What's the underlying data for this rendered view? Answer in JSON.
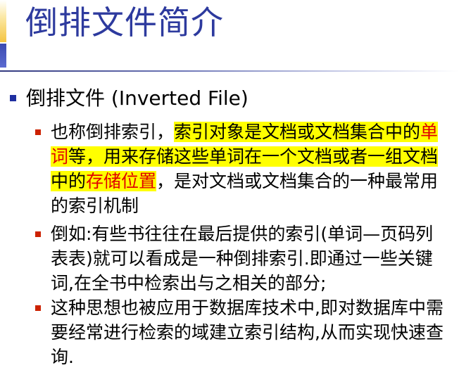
{
  "title": "倒排文件简介",
  "heading": "倒排文件 (Inverted File)",
  "bullets": [
    {
      "parts": [
        {
          "t": "也称倒排索引，",
          "hl": false,
          "red": false
        },
        {
          "t": "索引对象是文档或文档集合中的",
          "hl": true,
          "red": false
        },
        {
          "t": "单词",
          "hl": true,
          "red": true
        },
        {
          "t": "等，用来存储这些单词在一个文档或者一组文档中的",
          "hl": true,
          "red": false
        },
        {
          "t": "存储位置",
          "hl": true,
          "red": true
        },
        {
          "t": "，是对文档或文档集合的一种最常用的索引机制",
          "hl": false,
          "red": false
        }
      ]
    },
    {
      "parts": [
        {
          "t": "倒如:有些书往往在最后提供的索引(单词—页码列表表)就可以看成是一种倒排索引.即通过一些关键词,在全书中检索出与之相关的部分;",
          "hl": false,
          "red": false
        }
      ]
    },
    {
      "parts": [
        {
          "t": "这种思想也被应用于数据库技术中,即对数据库中需要经常进行检索的域建立索引结构,从而实现快速查询.",
          "hl": false,
          "red": false
        }
      ]
    }
  ]
}
